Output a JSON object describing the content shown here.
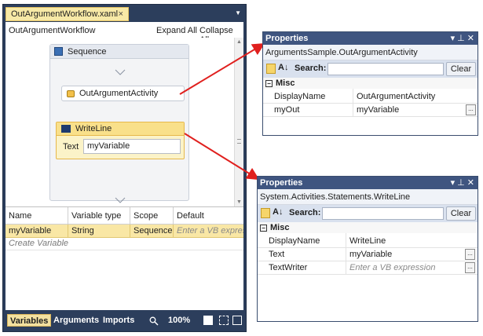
{
  "designer": {
    "tab_label": "OutArgumentWorkflow.xaml",
    "tab_close": "×",
    "workflow_title": "OutArgumentWorkflow",
    "expand_all": "Expand All",
    "collapse_all": "Collapse All",
    "sequence_label": "Sequence",
    "out_argument_activity_label": "OutArgumentActivity",
    "writeline_label": "WriteLine",
    "writeline_text_label": "Text",
    "writeline_text_value": "myVariable"
  },
  "variables": {
    "headers": [
      "Name",
      "Variable type",
      "Scope",
      "Default"
    ],
    "row": {
      "name": "myVariable",
      "type": "String",
      "scope": "Sequence",
      "default_placeholder": "Enter a VB expres"
    },
    "create_variable": "Create Variable"
  },
  "bottom_bar": {
    "tabs": [
      "Variables",
      "Arguments",
      "Imports"
    ],
    "zoom": "100%"
  },
  "properties_1": {
    "title": "Properties",
    "controls": "▾ ⊥ ✕",
    "type_name": "ArgumentsSample.OutArgumentActivity",
    "search_label": "Search:",
    "clear": "Clear",
    "category": "Misc",
    "rows": [
      {
        "name": "DisplayName",
        "value": "OutArgumentActivity"
      },
      {
        "name": "myOut",
        "value": "myVariable"
      }
    ]
  },
  "properties_2": {
    "title": "Properties",
    "controls": "▾ ⊥ ✕",
    "type_name": "System.Activities.Statements.WriteLine",
    "search_label": "Search:",
    "clear": "Clear",
    "category": "Misc",
    "rows": [
      {
        "name": "DisplayName",
        "value": "WriteLine"
      },
      {
        "name": "Text",
        "value": "myVariable"
      },
      {
        "name": "TextWriter",
        "value": "Enter a VB expression"
      }
    ]
  },
  "colors": {
    "arrow": "#e0201e",
    "frame": "#2c3e5c",
    "selection": "#f9e7a5",
    "props_title": "#3f5580"
  }
}
